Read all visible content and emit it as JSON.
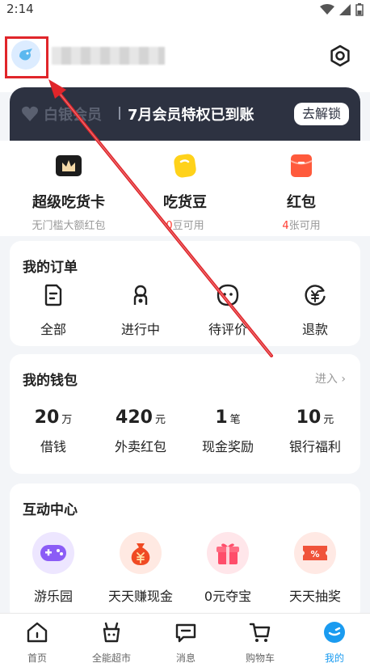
{
  "status": {
    "time": "2:14"
  },
  "vip": {
    "logo_text": "白银会员",
    "promo": "7月会员特权已到账",
    "button": "去解锁"
  },
  "assets": [
    {
      "title": "超级吃货卡",
      "sub_prefix": "",
      "sub_highlight": "",
      "sub_suffix": "无门槛大额红包"
    },
    {
      "title": "吃货豆",
      "sub_prefix": "",
      "sub_highlight": "0",
      "sub_suffix": "豆可用"
    },
    {
      "title": "红包",
      "sub_prefix": "",
      "sub_highlight": "4",
      "sub_suffix": "张可用"
    }
  ],
  "orders": {
    "title": "我的订单",
    "items": [
      {
        "label": "全部",
        "icon": "document-icon"
      },
      {
        "label": "进行中",
        "icon": "scooter-icon"
      },
      {
        "label": "待评价",
        "icon": "smile-icon"
      },
      {
        "label": "退款",
        "icon": "yuan-refund-icon"
      }
    ]
  },
  "wallet": {
    "title": "我的钱包",
    "link": "进入",
    "items": [
      {
        "num": "20",
        "unit": "万",
        "label": "借钱"
      },
      {
        "num": "420",
        "unit": "元",
        "label": "外卖红包"
      },
      {
        "num": "1",
        "unit": "笔",
        "label": "现金奖励"
      },
      {
        "num": "10",
        "unit": "元",
        "label": "银行福利"
      }
    ]
  },
  "fun": {
    "title": "互动中心",
    "items": [
      {
        "label": "游乐园",
        "icon": "gamepad-icon",
        "bg": "#ede6ff",
        "fg": "#8b5cf6"
      },
      {
        "label": "天天赚现金",
        "icon": "money-bag-icon",
        "bg": "#ffe9e2",
        "fg": "#f04a23"
      },
      {
        "label": "0元夺宝",
        "icon": "gift-icon",
        "bg": "#ffe6ea",
        "fg": "#ff4d6a"
      },
      {
        "label": "天天抽奖",
        "icon": "ticket-icon",
        "bg": "#ffe9e4",
        "fg": "#f0533a"
      }
    ]
  },
  "tabbar": [
    {
      "label": "首页",
      "icon": "home-icon",
      "active": false
    },
    {
      "label": "全能超市",
      "icon": "basket-icon",
      "active": false
    },
    {
      "label": "消息",
      "icon": "message-icon",
      "active": false
    },
    {
      "label": "购物车",
      "icon": "cart-icon",
      "active": false
    },
    {
      "label": "我的",
      "icon": "profile-icon",
      "active": true
    }
  ],
  "colors": {
    "accent": "#1a9bf0",
    "highlight": "#e0252a",
    "vip_bg": "#2d3241"
  }
}
